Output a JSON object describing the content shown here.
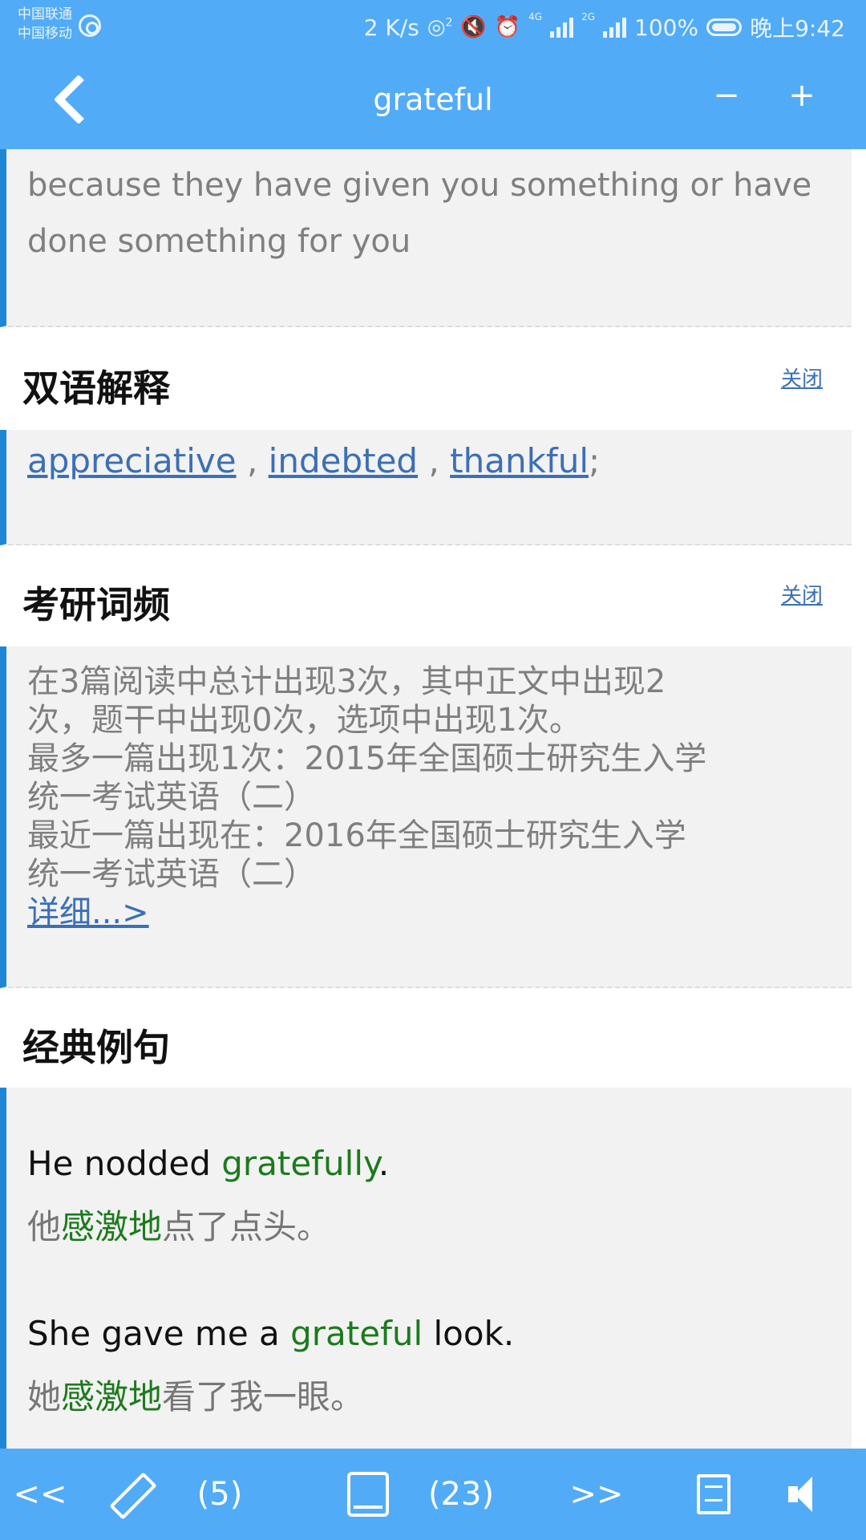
{
  "status_bar": {
    "carrier_1": "中国联通",
    "carrier_2": "中国移动",
    "speed": "2 K/s",
    "battery": "100%",
    "time": "晚上9:42",
    "net_1": "4G",
    "net_2": "2G",
    "hotspot_sup": "2"
  },
  "appbar": {
    "title": "grateful",
    "zoom_out": "−",
    "zoom_in": "+"
  },
  "definition": {
    "line_1": "because they have given you something or have",
    "line_2": "done something for you"
  },
  "bilingual": {
    "heading": "双语解释",
    "close_label": "关闭",
    "synonyms": [
      "appreciative",
      "indebted",
      "thankful"
    ],
    "separator": ",",
    "end": ";"
  },
  "exam_freq": {
    "heading": "考研词频",
    "close_label": "关闭",
    "line_1": "在3篇阅读中总计出现3次，其中正文中出现2",
    "line_2": "次，题干中出现0次，选项中出现1次。",
    "line_3": "最多一篇出现1次：2015年全国硕士研究生入学",
    "line_4": "统一考试英语（二）",
    "line_5": "最近一篇出现在：2016年全国硕士研究生入学",
    "line_6": "统一考试英语（二）",
    "detail_link": "详细...>"
  },
  "examples": {
    "heading": "经典例句",
    "items": [
      {
        "en_before": "He nodded ",
        "en_hl": "gratefully",
        "en_after": ".",
        "zh_before": "他",
        "zh_hl": "感激地",
        "zh_after": "点了点头。"
      },
      {
        "en_before": "She gave me a ",
        "en_hl": "grateful",
        "en_after": " look.",
        "zh_before": "她",
        "zh_hl": "感激地",
        "zh_after": "看了我一眼。"
      }
    ]
  },
  "bottom_bar": {
    "prev": "<<",
    "notes_count": "(5)",
    "book_count": "(23)",
    "next": ">>"
  },
  "colors": {
    "bar": "#52abf6",
    "accent_border": "#1d86d6",
    "highlight": "#1c7a1c",
    "link": "#3c6fb5"
  }
}
